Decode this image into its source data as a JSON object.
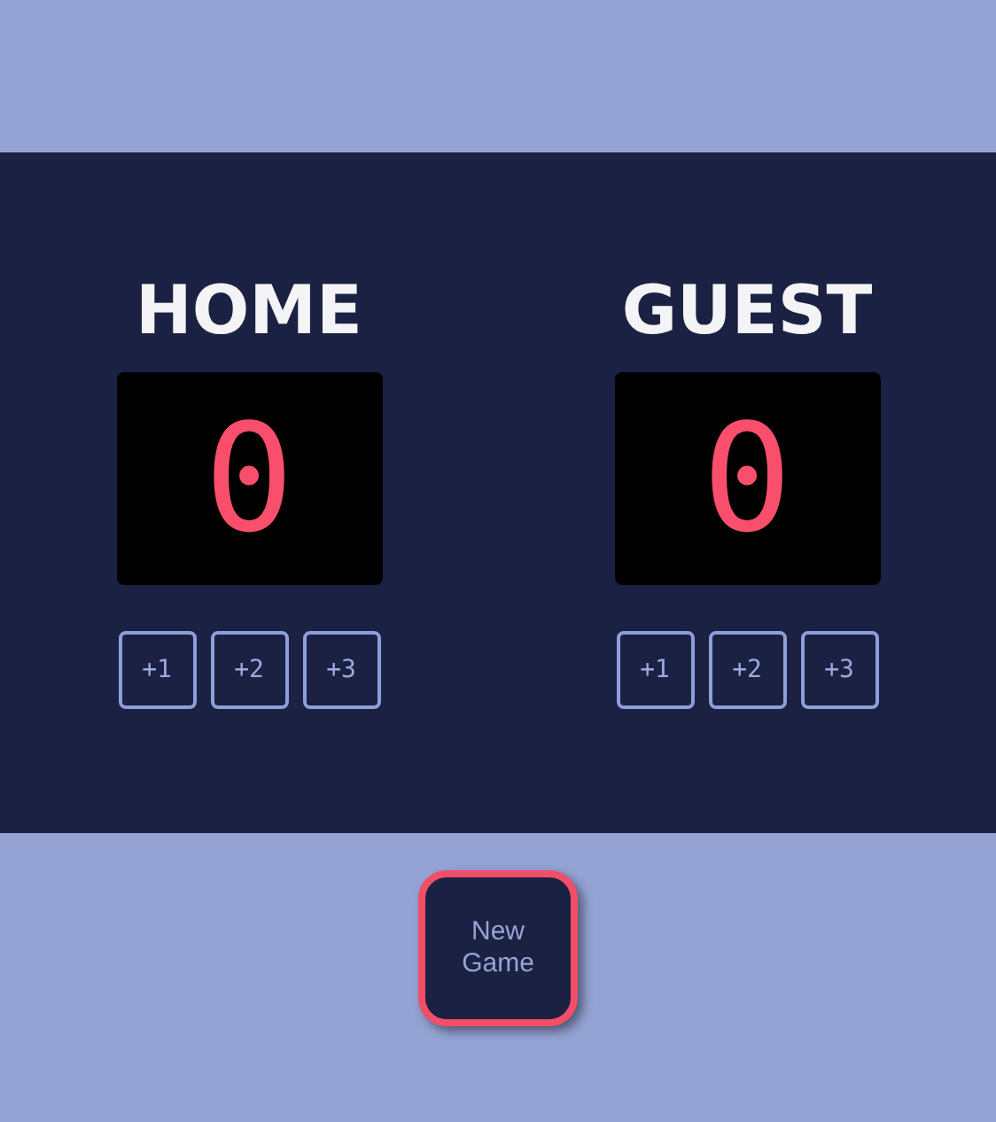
{
  "teams": [
    {
      "name": "HOME",
      "score": "0",
      "buttons": [
        "+1",
        "+2",
        "+3"
      ]
    },
    {
      "name": "GUEST",
      "score": "0",
      "buttons": [
        "+1",
        "+2",
        "+3"
      ]
    }
  ],
  "new_game_button": "New\nGame"
}
